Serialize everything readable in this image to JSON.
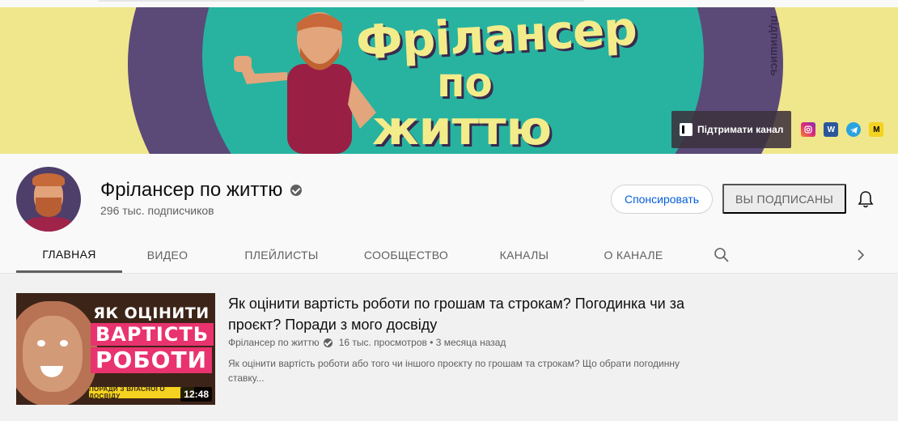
{
  "banner": {
    "title_line1": "Фрілансер",
    "title_line2": "по",
    "title_line3": "життю",
    "side_text": "підпишись",
    "support_label": "Підтримати канал",
    "links": [
      "instagram-icon",
      "w-icon",
      "telegram-icon",
      "m-icon"
    ],
    "colors": {
      "background": "#f0e68c",
      "circle": "#5b4a78",
      "teal": "#27b3a0",
      "title": "#f3ec8a"
    }
  },
  "channel": {
    "name": "Фрілансер по життю",
    "subscribers": "296 тыс. подписчиков",
    "sponsor_label": "Спонсировать",
    "subscribed_label": "ВЫ ПОДПИСАНЫ"
  },
  "tabs": [
    {
      "label": "ГЛАВНАЯ",
      "active": true
    },
    {
      "label": "ВИДЕО",
      "active": false
    },
    {
      "label": "ПЛЕЙЛИСТЫ",
      "active": false
    },
    {
      "label": "СООБЩЕСТВО",
      "active": false
    },
    {
      "label": "КАНАЛЫ",
      "active": false
    },
    {
      "label": "О КАНАЛЕ",
      "active": false
    }
  ],
  "featured_video": {
    "thumb_line1": "ЯК ОЦІНИТИ",
    "thumb_line2": "ВАРТІСТЬ",
    "thumb_line3": "РОБОТИ",
    "thumb_strip": "ПОРАДИ З ВЛАСНОГО ДОСВІДУ",
    "duration": "12:48",
    "title": "Як оцінити вартість роботи по грошам та строкам? Погодинка чи за проєкт? Поради з мого досвіду",
    "channel": "Фрілансер по життю",
    "views_age": "16 тыс. просмотров • 3 месяца назад",
    "description": "Як оцінити вартість роботи або того чи іншого проєкту по грошам та строкам? Що обрати погодинну ставку..."
  }
}
